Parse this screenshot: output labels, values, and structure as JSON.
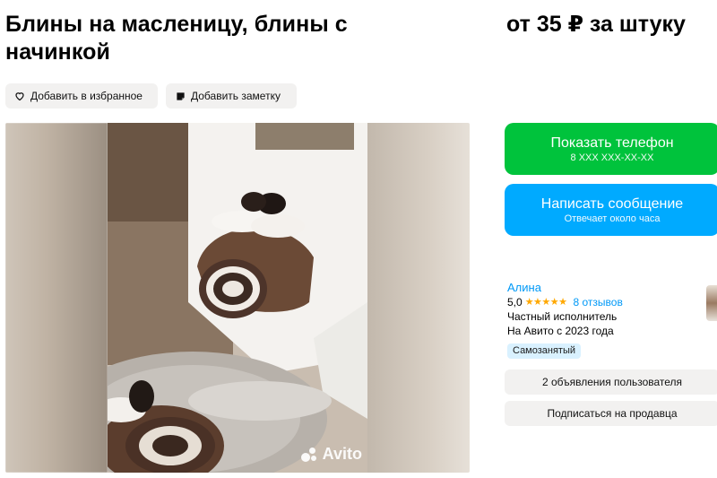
{
  "listing": {
    "title": "Блины на масленицу, блины с начинкой",
    "price": "от 35 ₽ за штуку"
  },
  "actions": {
    "favorite_label": "Добавить в избранное",
    "note_label": "Добавить заметку"
  },
  "gallery": {
    "watermark": "Avito"
  },
  "contact": {
    "phone_label": "Показать телефон",
    "phone_masked": "8 XXX XXX-XX-XX",
    "message_label": "Написать сообщение",
    "message_sub": "Отвечает около часа"
  },
  "seller": {
    "name": "Алина",
    "rating": "5,0",
    "stars": "★★★★★",
    "reviews": "8 отзывов",
    "type": "Частный исполнитель",
    "since": "На Авито с 2023 года",
    "badge": "Самозанятый",
    "ads_button": "2 объявления пользователя",
    "subscribe_button": "Подписаться на продавца"
  },
  "colors": {
    "green": "#00c33c",
    "blue": "#00aaff",
    "link": "#0099f7",
    "star": "#ffa800",
    "pill_bg": "#f2f1f0"
  },
  "icons": {
    "favorite": "heart-icon",
    "note": "note-icon"
  }
}
